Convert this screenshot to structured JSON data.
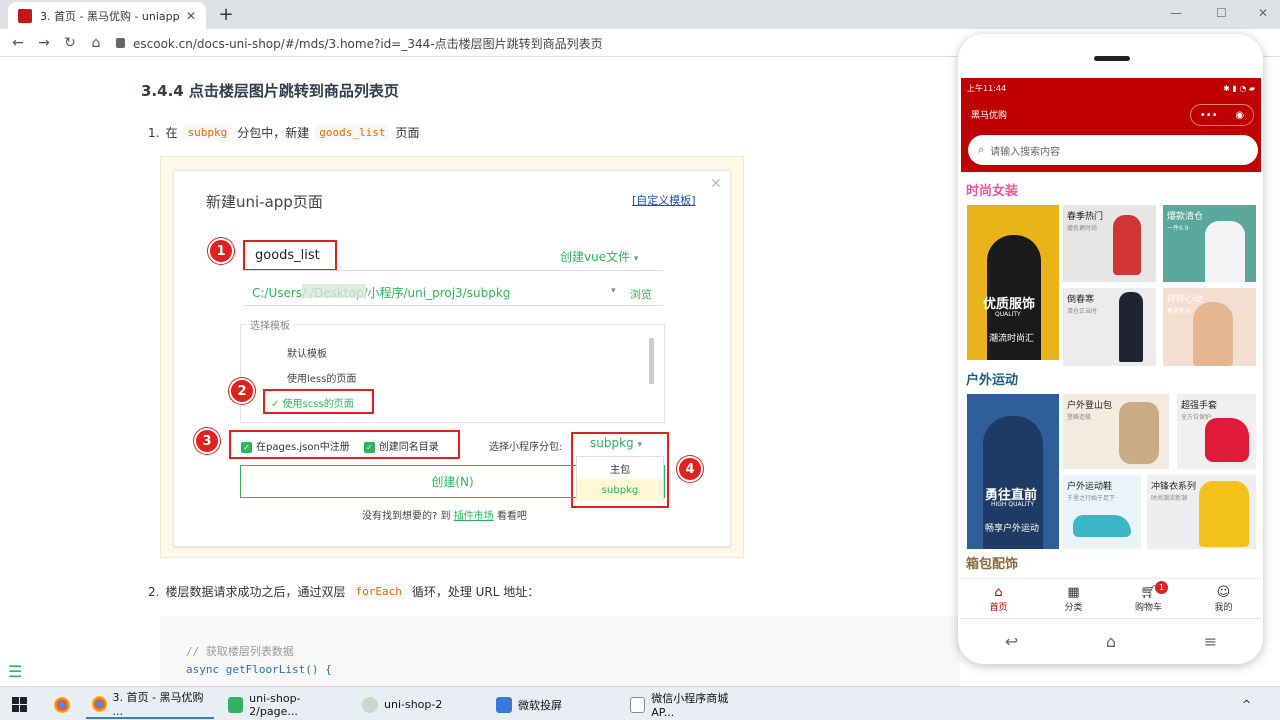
{
  "browser": {
    "tab_title": "3. 首页 - 黑马优购 - uniapp",
    "tab_close": "✕",
    "new_tab": "+",
    "url": "escook.cn/docs-uni-shop/#/mds/3.home?id=_344-点击楼层图片跳转到商品列表页",
    "win_min": "—",
    "win_max": "☐",
    "win_close": "✕",
    "nav_back": "←",
    "nav_forward": "→",
    "nav_reload": "↻",
    "nav_home": "⌂"
  },
  "doc": {
    "section_title": "3.4.4 点击楼层图片跳转到商品列表页",
    "step1": {
      "num": "1.",
      "prefix": "在",
      "code1": "subpkg",
      "mid": "分包中，新建",
      "code2": "goods_list",
      "suffix": "页面"
    },
    "step2": {
      "num": "2.",
      "prefix": "楼层数据请求成功之后，通过双层",
      "code": "forEach",
      "suffix": "循环，处理 URL 地址："
    },
    "code_lines": [
      "// 获取楼层列表数据",
      "async getFloorList() {"
    ]
  },
  "dialog": {
    "title": "新建uni-app页面",
    "custom_template_link": "[自定义模板]",
    "close": "✕",
    "page_name": "goods_list",
    "create_vue": "创建vue文件",
    "path": "C:/Users/          /Desktop/小程序/uni_proj3/subpkg",
    "browse": "浏览",
    "template_legend": "选择模板",
    "template_items": [
      "默认模板",
      "使用less的页面",
      "使用scss的页面"
    ],
    "register_pages_json": "在pages.json中注册",
    "create_same_dir": "创建同名目录",
    "choose_subpkg_label": "选择小程序分包:",
    "subpkg_value": "subpkg",
    "dropdown_options": [
      "主包",
      "subpkg"
    ],
    "create_button": "创建(N)",
    "footer_prefix": "没有找到想要的? 到",
    "footer_link": "插件市场",
    "footer_suffix": "看看吧",
    "markers": [
      "1",
      "2",
      "3",
      "4"
    ]
  },
  "phone": {
    "status_time": "上午11:44",
    "status_icons": "✱ ▮ ◔ ▰",
    "nav_title": "黑马优购",
    "capsule_dots": "•••",
    "capsule_target": "◉",
    "search_placeholder": "请输入搜索内容",
    "floors": [
      {
        "title": "时尚女装",
        "main_caption": "优质服饰",
        "main_sub": "QUALITY",
        "main_tag": "潮流时尚汇",
        "tiles": [
          {
            "t": "春季热门",
            "s": "撞色更时尚"
          },
          {
            "t": "爆款清仓",
            "s": "一件9.9"
          },
          {
            "t": "倒春寒",
            "s": "清仓正当时"
          },
          {
            "t": "砰砰心动",
            "s": "春夏新品"
          }
        ]
      },
      {
        "title": "户外运动",
        "main_caption": "勇往直前",
        "main_sub": "HIGH QUALITY",
        "main_tag": "畅享户外运动",
        "tiles": [
          {
            "t": "户外登山包",
            "s": "登峰造极"
          },
          {
            "t": "超强手套",
            "s": "全方位保护"
          },
          {
            "t": "户外运动鞋",
            "s": "千里之行始于足下"
          },
          {
            "t": "冲锋衣系列",
            "s": "时尚潮流新潮"
          }
        ]
      },
      {
        "title": "箱包配饰"
      }
    ],
    "tabs": [
      "首页",
      "分类",
      "购物车",
      "我的"
    ],
    "cart_badge": "1",
    "sys_nav": [
      "↩",
      "⌂",
      "≡"
    ]
  },
  "taskbar": {
    "items": [
      "3. 首页 - 黑马优购 ...",
      "uni-shop-2/page...",
      "uni-shop-2",
      "微软投屏",
      "微信小程序商城AP..."
    ],
    "tray": "^"
  },
  "colors": {
    "brand_red": "#c00000",
    "hbuilder_green": "#2fb45b",
    "annotation_red": "#e0211e"
  }
}
